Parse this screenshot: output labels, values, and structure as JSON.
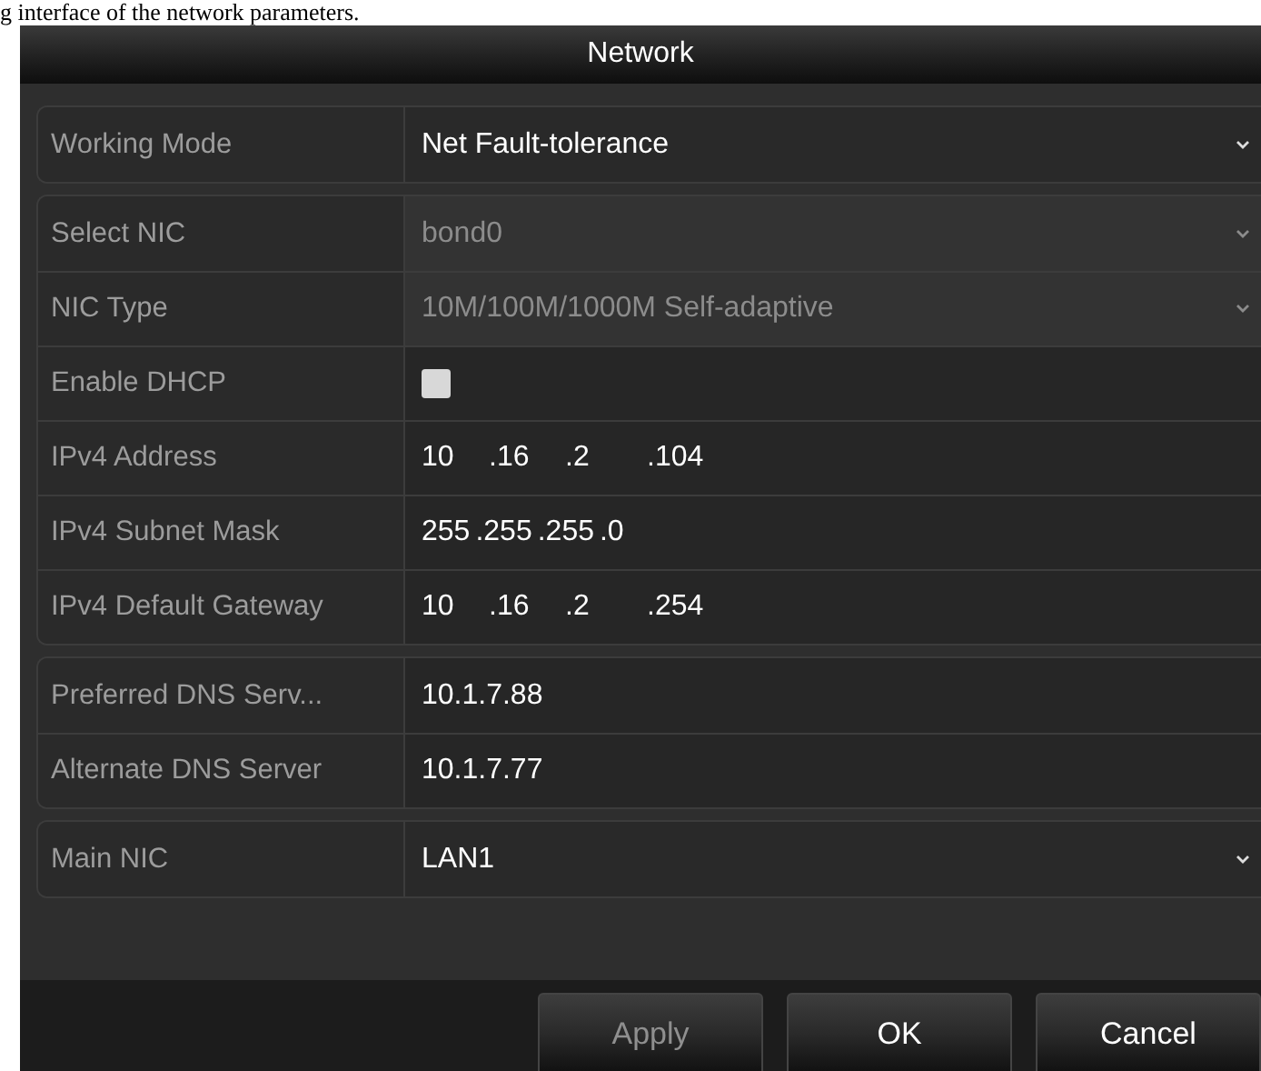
{
  "caption": "g interface of the network parameters.",
  "window": {
    "title": "Network"
  },
  "groups": [
    {
      "rows": [
        {
          "kind": "select",
          "label": "Working Mode",
          "value": "Net Fault-tolerance",
          "disabled": false
        }
      ]
    },
    {
      "rows": [
        {
          "kind": "select",
          "label": "Select NIC",
          "value": "bond0",
          "disabled": true
        },
        {
          "kind": "select",
          "label": "NIC Type",
          "value": "10M/100M/1000M Self-adaptive",
          "disabled": true
        },
        {
          "kind": "checkbox",
          "label": "Enable DHCP",
          "checked": false
        },
        {
          "kind": "ip",
          "label": "IPv4 Address",
          "segments": [
            "10",
            ".16",
            ".2",
            ".104"
          ]
        },
        {
          "kind": "ip",
          "label": "IPv4 Subnet Mask",
          "segments": [
            "255",
            ".255",
            ".255",
            ".0"
          ]
        },
        {
          "kind": "ip",
          "label": "IPv4 Default Gateway",
          "segments": [
            "10",
            ".16",
            ".2",
            ".254"
          ]
        }
      ]
    },
    {
      "rows": [
        {
          "kind": "text",
          "label": "Preferred DNS Serv...",
          "value": "10.1.7.88"
        },
        {
          "kind": "text",
          "label": "Alternate DNS Server",
          "value": "10.1.7.77"
        }
      ]
    },
    {
      "rows": [
        {
          "kind": "select",
          "label": "Main NIC",
          "value": "LAN1",
          "disabled": false
        }
      ]
    }
  ],
  "buttons": [
    {
      "label": "Apply",
      "disabled": true
    },
    {
      "label": "OK",
      "disabled": false
    },
    {
      "label": "Cancel",
      "disabled": false
    }
  ]
}
